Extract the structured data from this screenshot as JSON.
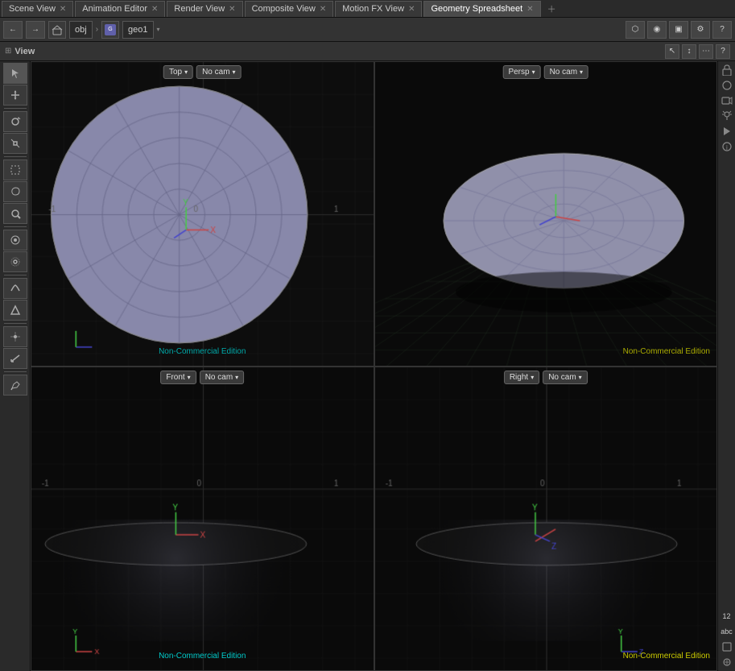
{
  "tabs": [
    {
      "label": "Scene View",
      "active": false
    },
    {
      "label": "Animation Editor",
      "active": false
    },
    {
      "label": "Render View",
      "active": false
    },
    {
      "label": "Composite View",
      "active": false
    },
    {
      "label": "Motion FX View",
      "active": false
    },
    {
      "label": "Geometry Spreadsheet",
      "active": true
    }
  ],
  "toolbar": {
    "back_label": "←",
    "forward_label": "→",
    "obj_label": "obj",
    "geo_label": "geo1",
    "dropdown_arrow": "▾"
  },
  "view_header": {
    "title": "View"
  },
  "viewports": [
    {
      "id": "top-left",
      "view_mode": "Top",
      "camera": "No cam",
      "watermark": "Non-Commercial Edition",
      "watermark_color": "#00cccc"
    },
    {
      "id": "top-right",
      "view_mode": "Persp",
      "camera": "No cam",
      "watermark": "Non-Commercial Edition",
      "watermark_color": "#cccc00"
    },
    {
      "id": "bottom-left",
      "view_mode": "Front",
      "camera": "No cam",
      "watermark": "Non-Commercial Edition",
      "watermark_color": "#00cccc"
    },
    {
      "id": "bottom-right",
      "view_mode": "Right",
      "camera": "No cam",
      "watermark": "Non-Commercial Edition",
      "watermark_color": "#cccc00"
    }
  ],
  "left_toolbar": {
    "buttons": [
      "select",
      "transform",
      "rotate",
      "scale",
      "box-select",
      "lasso-select",
      "paint-select",
      "snap",
      "soft-transform",
      "sculpt",
      "view-transform",
      "pivot",
      "mirror",
      "measure",
      "annotate"
    ]
  },
  "right_toolbar": {
    "items": [
      "lock",
      "display",
      "camera",
      "light",
      "render",
      "abc",
      "info"
    ]
  },
  "status": {
    "twelve": "12",
    "abc": "abc"
  }
}
